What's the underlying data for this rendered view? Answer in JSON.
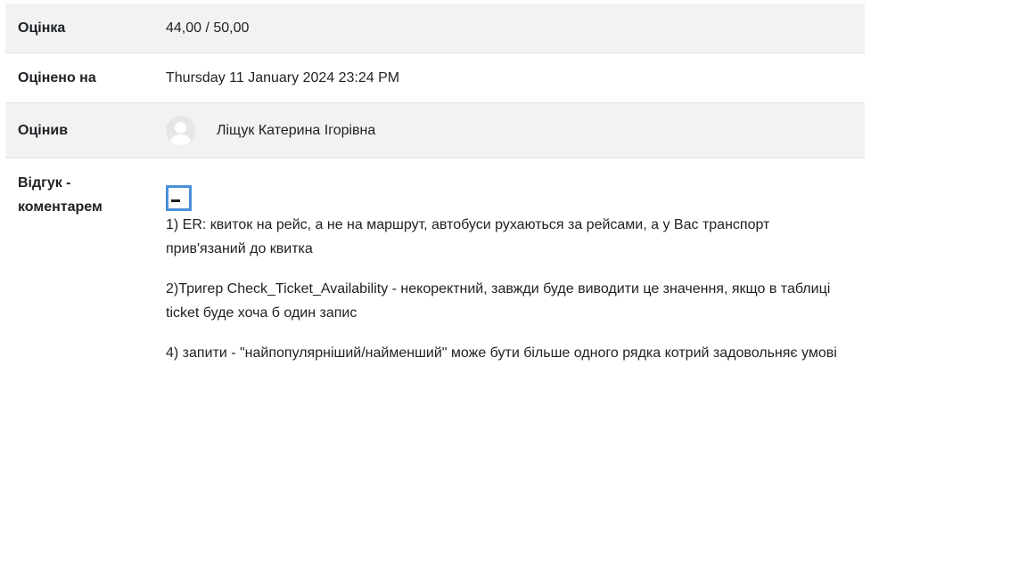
{
  "grade": {
    "label": "Оцінка",
    "value": "44,00 / 50,00"
  },
  "graded_on": {
    "label": "Оцінено на",
    "value": "Thursday 11 January 2024 23:24 PM"
  },
  "grader": {
    "label": "Оцінив",
    "name": "Ліщук Катерина Ігорівна"
  },
  "feedback": {
    "label_line1": "Відгук -",
    "label_line2": "коментарем",
    "paragraphs": [
      "1) ER: квиток на рейс, а не на маршрут, автобуси рухаються за рейсами, а у Вас транспорт прив'язаний до квитка",
      "2)Тригер Check_Ticket_Availability  - некоректний, завжди буде виводити це значення, якщо в таблиці ticket буде хоча б один запис",
      "4) запити - \"найпопулярніший/найменший\" може бути більше одного рядка котрий задовольняє умові"
    ]
  },
  "colors": {
    "row_shade": "#f2f2f2",
    "focus_outline": "#4a90d9"
  },
  "icons": {
    "avatar": "user-avatar-icon",
    "collapse": "minus-icon"
  }
}
